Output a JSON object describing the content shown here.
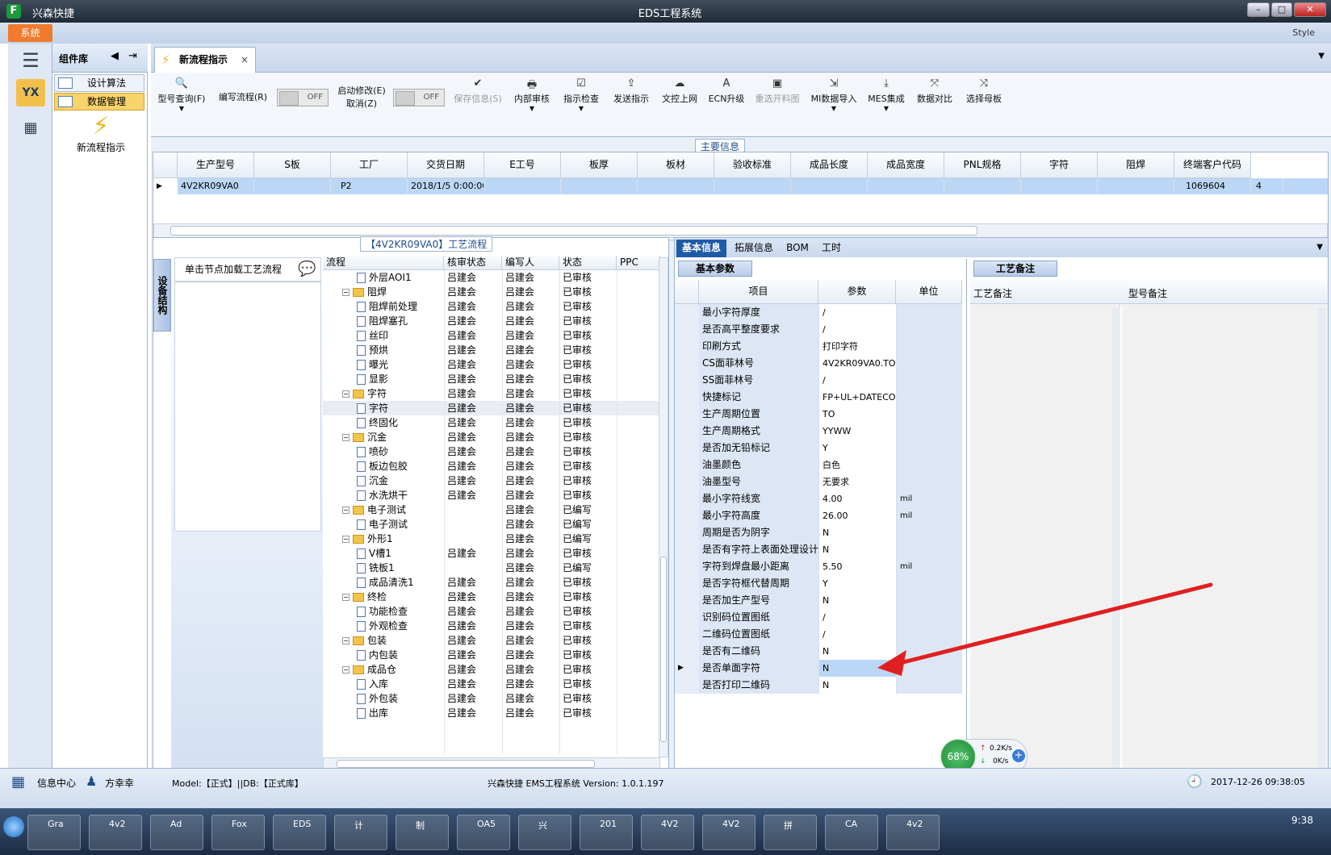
{
  "titlebar": {
    "app_title": "兴森快捷",
    "window_title": "EDS工程系统",
    "logo_letter": "F"
  },
  "menubar": {
    "system": "系统",
    "style": "Style"
  },
  "leftbar": {
    "logo_text": "YX"
  },
  "component_library": {
    "header": "组件库",
    "items": [
      "设计算法",
      "数据管理"
    ],
    "active_index": 1,
    "app_tile_label": "新流程指示"
  },
  "doc_tab": {
    "label": "新流程指示",
    "close": "×"
  },
  "toolbar": {
    "items": [
      {
        "label": "型号查询(F)",
        "icon": "search-icon",
        "dropdown": true,
        "enabled": true
      },
      {
        "label": "编写流程(R)",
        "icon": "",
        "dropdown": false,
        "enabled": true
      },
      {
        "label": "启动修改(E)",
        "sub_label": "取消(Z)",
        "icon": "",
        "enabled": true
      },
      {
        "label": "保存信息(S)",
        "icon": "check-icon",
        "enabled": false
      },
      {
        "label": "内部审核",
        "icon": "print-icon",
        "dropdown": true,
        "enabled": true
      },
      {
        "label": "指示检查",
        "icon": "checklist-icon",
        "dropdown": true,
        "enabled": true
      },
      {
        "label": "发送指示",
        "icon": "upload-icon",
        "enabled": true
      },
      {
        "label": "文控上网",
        "icon": "cloud-upload-icon",
        "enabled": true
      },
      {
        "label": "ECN升级",
        "icon": "ecn-icon",
        "enabled": true
      },
      {
        "label": "重选开料图",
        "icon": "image-icon",
        "enabled": false
      },
      {
        "label": "MI数据导入",
        "icon": "import-icon",
        "dropdown": true,
        "enabled": true
      },
      {
        "label": "MES集成",
        "icon": "download-icon",
        "dropdown": true,
        "enabled": true
      },
      {
        "label": "数据对比",
        "icon": "compare-icon",
        "enabled": true
      },
      {
        "label": "选择母板",
        "icon": "shuffle-icon",
        "enabled": true
      }
    ],
    "toggle_off_1": "OFF",
    "toggle_off_2": "OFF"
  },
  "main_info": {
    "section_label": "主要信息",
    "columns": [
      "生产型号",
      "S板",
      "工厂",
      "交货日期",
      "E工号",
      "板厚",
      "板材",
      "验收标准",
      "成品长度",
      "成品宽度",
      "PNL规格",
      "字符",
      "阻焊",
      "终端客户代码"
    ],
    "row": [
      "4V2KR09VA0",
      "",
      "P2",
      "2018/1/5 0:00:00",
      "",
      "",
      "",
      "",
      "",
      "",
      "",
      "",
      "",
      "1069604"
    ],
    "row_trailing": "4"
  },
  "process_flow": {
    "section_label": "【4V2KR09VA0】工艺流程",
    "vertical_tab": "设备结构",
    "node_hint": "单击节点加载工艺流程",
    "columns": [
      "流程",
      "核审状态",
      "编写人",
      "状态",
      "PPC"
    ],
    "rows": [
      {
        "level": 2,
        "type": "doc",
        "name": "外层AOI1",
        "review": "吕建会",
        "author": "吕建会",
        "status": "已审核"
      },
      {
        "level": 1,
        "type": "folder",
        "name": "阻焊",
        "review": "吕建会",
        "author": "吕建会",
        "status": "已审核"
      },
      {
        "level": 2,
        "type": "doc",
        "name": "阻焊前处理",
        "review": "吕建会",
        "author": "吕建会",
        "status": "已审核"
      },
      {
        "level": 2,
        "type": "doc",
        "name": "阻焊塞孔",
        "review": "吕建会",
        "author": "吕建会",
        "status": "已审核"
      },
      {
        "level": 2,
        "type": "doc",
        "name": "丝印",
        "review": "吕建会",
        "author": "吕建会",
        "status": "已审核"
      },
      {
        "level": 2,
        "type": "doc",
        "name": "预烘",
        "review": "吕建会",
        "author": "吕建会",
        "status": "已审核"
      },
      {
        "level": 2,
        "type": "doc",
        "name": "曝光",
        "review": "吕建会",
        "author": "吕建会",
        "status": "已审核"
      },
      {
        "level": 2,
        "type": "doc",
        "name": "显影",
        "review": "吕建会",
        "author": "吕建会",
        "status": "已审核"
      },
      {
        "level": 1,
        "type": "folder",
        "name": "字符",
        "review": "吕建会",
        "author": "吕建会",
        "status": "已审核"
      },
      {
        "level": 2,
        "type": "doc",
        "name": "字符",
        "review": "吕建会",
        "author": "吕建会",
        "status": "已审核",
        "selected": true
      },
      {
        "level": 2,
        "type": "doc",
        "name": "终固化",
        "review": "吕建会",
        "author": "吕建会",
        "status": "已审核"
      },
      {
        "level": 1,
        "type": "folder",
        "name": "沉金",
        "review": "吕建会",
        "author": "吕建会",
        "status": "已审核"
      },
      {
        "level": 2,
        "type": "doc",
        "name": "喷砂",
        "review": "吕建会",
        "author": "吕建会",
        "status": "已审核"
      },
      {
        "level": 2,
        "type": "doc",
        "name": "板边包胶",
        "review": "吕建会",
        "author": "吕建会",
        "status": "已审核"
      },
      {
        "level": 2,
        "type": "doc",
        "name": "沉金",
        "review": "吕建会",
        "author": "吕建会",
        "status": "已审核"
      },
      {
        "level": 2,
        "type": "doc",
        "name": "水洗烘干",
        "review": "吕建会",
        "author": "吕建会",
        "status": "已审核"
      },
      {
        "level": 1,
        "type": "folder",
        "name": "电子测试",
        "review": "",
        "author": "吕建会",
        "status": "已编写"
      },
      {
        "level": 2,
        "type": "doc",
        "name": "电子测试",
        "review": "",
        "author": "吕建会",
        "status": "已编写"
      },
      {
        "level": 1,
        "type": "folder",
        "name": "外形1",
        "review": "",
        "author": "吕建会",
        "status": "已编写"
      },
      {
        "level": 2,
        "type": "doc",
        "name": "V槽1",
        "review": "吕建会",
        "author": "吕建会",
        "status": "已审核"
      },
      {
        "level": 2,
        "type": "doc",
        "name": "铣板1",
        "review": "",
        "author": "吕建会",
        "status": "已编写"
      },
      {
        "level": 2,
        "type": "doc",
        "name": "成品清洗1",
        "review": "吕建会",
        "author": "吕建会",
        "status": "已审核"
      },
      {
        "level": 1,
        "type": "folder",
        "name": "终检",
        "review": "吕建会",
        "author": "吕建会",
        "status": "已审核"
      },
      {
        "level": 2,
        "type": "doc",
        "name": "功能检查",
        "review": "吕建会",
        "author": "吕建会",
        "status": "已审核"
      },
      {
        "level": 2,
        "type": "doc",
        "name": "外观检查",
        "review": "吕建会",
        "author": "吕建会",
        "status": "已审核"
      },
      {
        "level": 1,
        "type": "folder",
        "name": "包装",
        "review": "吕建会",
        "author": "吕建会",
        "status": "已审核"
      },
      {
        "level": 2,
        "type": "doc",
        "name": "内包装",
        "review": "吕建会",
        "author": "吕建会",
        "status": "已审核"
      },
      {
        "level": 1,
        "type": "folder",
        "name": "成品仓",
        "review": "吕建会",
        "author": "吕建会",
        "status": "已审核"
      },
      {
        "level": 2,
        "type": "doc",
        "name": "入库",
        "review": "吕建会",
        "author": "吕建会",
        "status": "已审核"
      },
      {
        "level": 2,
        "type": "doc",
        "name": "外包装",
        "review": "吕建会",
        "author": "吕建会",
        "status": "已审核"
      },
      {
        "level": 2,
        "type": "doc",
        "name": "出库",
        "review": "吕建会",
        "author": "吕建会",
        "status": "已审核"
      }
    ]
  },
  "info_tabs": [
    "基本信息",
    "拓展信息",
    "BOM",
    "工时"
  ],
  "basic_params": {
    "section_label": "基本参数",
    "columns": [
      "项目",
      "参数",
      "单位"
    ],
    "rows": [
      {
        "item": "最小字符厚度",
        "value": "/",
        "unit": ""
      },
      {
        "item": "是否高平整度要求",
        "value": "/",
        "unit": ""
      },
      {
        "item": "印刷方式",
        "value": "打印字符",
        "unit": ""
      },
      {
        "item": "CS面菲林号",
        "value": "4V2KR09VA0.TO",
        "unit": ""
      },
      {
        "item": "SS面菲林号",
        "value": "/",
        "unit": ""
      },
      {
        "item": "快捷标记",
        "value": "FP+UL+DATECODE",
        "unit": ""
      },
      {
        "item": "生产周期位置",
        "value": "TO",
        "unit": ""
      },
      {
        "item": "生产周期格式",
        "value": "YYWW",
        "unit": ""
      },
      {
        "item": "是否加无铅标记",
        "value": "Y",
        "unit": ""
      },
      {
        "item": "油墨颜色",
        "value": "白色",
        "unit": ""
      },
      {
        "item": "油墨型号",
        "value": "无要求",
        "unit": ""
      },
      {
        "item": "最小字符线宽",
        "value": "4.00",
        "unit": "mil"
      },
      {
        "item": "最小字符高度",
        "value": "26.00",
        "unit": "mil"
      },
      {
        "item": "周期是否为阴字",
        "value": "N",
        "unit": ""
      },
      {
        "item": "是否有字符上表面处理设计",
        "value": "N",
        "unit": ""
      },
      {
        "item": "字符到焊盘最小距离",
        "value": "5.50",
        "unit": "mil"
      },
      {
        "item": "是否字符框代替周期",
        "value": "Y",
        "unit": ""
      },
      {
        "item": "是否加生产型号",
        "value": "N",
        "unit": ""
      },
      {
        "item": "识别码位置图纸",
        "value": "/",
        "unit": ""
      },
      {
        "item": "二维码位置图纸",
        "value": "/",
        "unit": ""
      },
      {
        "item": "是否有二维码",
        "value": "N",
        "unit": ""
      },
      {
        "item": "是否单面字符",
        "value": "N",
        "unit": "",
        "selected": true
      },
      {
        "item": "是否打印二维码",
        "value": "N",
        "unit": ""
      }
    ]
  },
  "process_notes": {
    "section_label": "工艺备注",
    "columns": [
      "工艺备注",
      "型号备注"
    ]
  },
  "net_widget": {
    "percent": "68%",
    "up": "0.2K/s",
    "down": "0K/s"
  },
  "statusbar": {
    "info_center": "信息中心",
    "user": "方幸幸",
    "model": "Model:【正式】||DB:【正式库】",
    "version": "兴森快捷 EMS工程系统 Version: 1.0.1.197",
    "datetime": "2017-12-26 09:38:05"
  },
  "taskbar": {
    "items": [
      "Gra",
      "4v2",
      "Ad",
      "Fox",
      "EDS",
      "计",
      "制",
      "OA5",
      "兴",
      "201",
      "4V2",
      "4V2",
      "拼",
      "CA",
      "4v2"
    ],
    "clock": "9:38"
  },
  "colors": {
    "accent_orange": "#f07a2e",
    "selection_blue": "#bcd7f5",
    "arrow_red": "#e02020"
  }
}
